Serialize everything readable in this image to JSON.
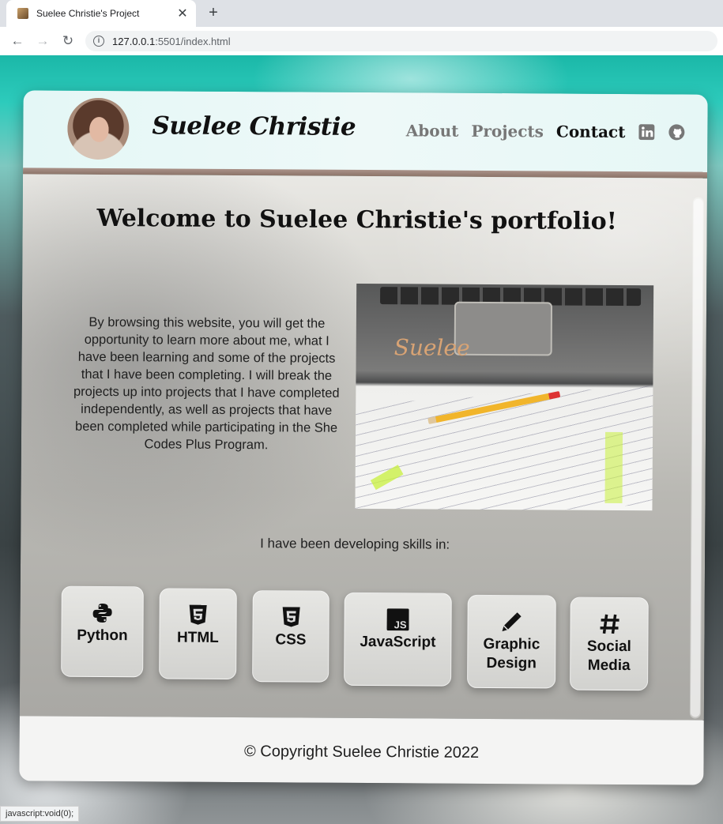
{
  "browser": {
    "tab_title": "Suelee Christie's Project",
    "tab_close": "✕",
    "new_tab": "+",
    "back": "←",
    "forward": "→",
    "reload": "↻",
    "url_prefix": "127.0.0.1",
    "url_rest": ":5501/index.html",
    "status_text": "javascript:void(0);"
  },
  "header": {
    "brand": "Suelee Christie",
    "nav": [
      "About",
      "Projects",
      "Contact"
    ],
    "social": [
      "linkedin-icon",
      "github-icon"
    ]
  },
  "main": {
    "welcome": "Welcome to Suelee Christie's portfolio!",
    "intro": "By browsing this website, you will get the opportunity to learn more about me, what I have been learning and some of the projects that I have been completing. I will break the projects up into projects that I have completed independently, as well as projects that have been completed while participating in the She Codes Plus Program.",
    "photo_logo": "Suelee",
    "skills_label": "I have been developing skills in:",
    "skills": [
      {
        "label": "Python",
        "icon": "python-icon"
      },
      {
        "label": "HTML",
        "icon": "html5-icon"
      },
      {
        "label": "CSS",
        "icon": "css3-icon"
      },
      {
        "label": "JavaScript",
        "icon": "js-icon"
      },
      {
        "label": "Graphic Design",
        "icon": "pencil-icon"
      },
      {
        "label": "Social Media",
        "icon": "hashtag-icon"
      }
    ]
  },
  "footer": {
    "copyright": "© Copyright Suelee Christie 2022"
  }
}
